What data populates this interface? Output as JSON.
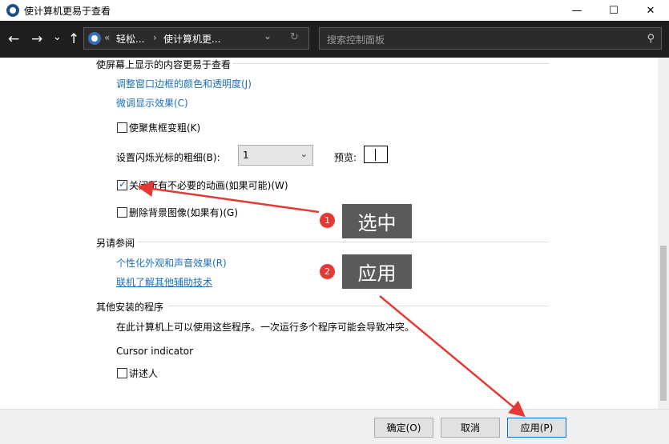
{
  "window": {
    "title": "使计算机更易于查看",
    "minimize_glyph": "—",
    "maximize_glyph": "☐",
    "close_glyph": "✕"
  },
  "nav": {
    "back_glyph": "←",
    "forward_glyph": "→",
    "recent_glyph": "⌄",
    "up_glyph": "↑",
    "breadcrumb_overflow": "«",
    "breadcrumb_1": "轻松...",
    "breadcrumb_sep": "›",
    "breadcrumb_2": "使计算机更...",
    "dropdown_glyph": "⌄",
    "refresh_glyph": "↻",
    "search_placeholder": "搜索控制面板",
    "search_glyph": "⚲"
  },
  "content": {
    "section_display": "使屏幕上显示的内容更易于查看",
    "link_border_color": "调整窗口边框的颜色和透明度(J)",
    "link_fine_tune": "微调显示效果(C)",
    "cb_focus_rect": "使聚焦框变粗(K)",
    "cursor_width_label": "设置闪烁光标的粗细(B):",
    "cursor_width_value": "1",
    "preview_label": "预览:",
    "cb_animations": "关闭所有不必要的动画(如果可能)(W)",
    "cb_animations_checked": true,
    "cb_background": "删除背景图像(如果有)(G)",
    "section_see_also": "另请参阅",
    "link_personalize": "个性化外观和声音效果(R)",
    "link_assistive": "联机了解其他辅助技术",
    "section_other_programs": "其他安装的程序",
    "other_programs_desc": "在此计算机上可以使用这些程序。一次运行多个程序可能会导致冲突。",
    "program_name": "Cursor indicator",
    "cb_narrator": "讲述人"
  },
  "buttons": {
    "ok": "确定(O)",
    "cancel": "取消",
    "apply": "应用(P)"
  },
  "annotations": {
    "step1_badge": "1",
    "step1_text": "选中",
    "step2_badge": "2",
    "step2_text": "应用"
  },
  "colors": {
    "link": "#1a6fbf",
    "arrow": "#e53935",
    "callout_bg": "#5a5a5a",
    "nav_bg": "#1e1e1e"
  }
}
